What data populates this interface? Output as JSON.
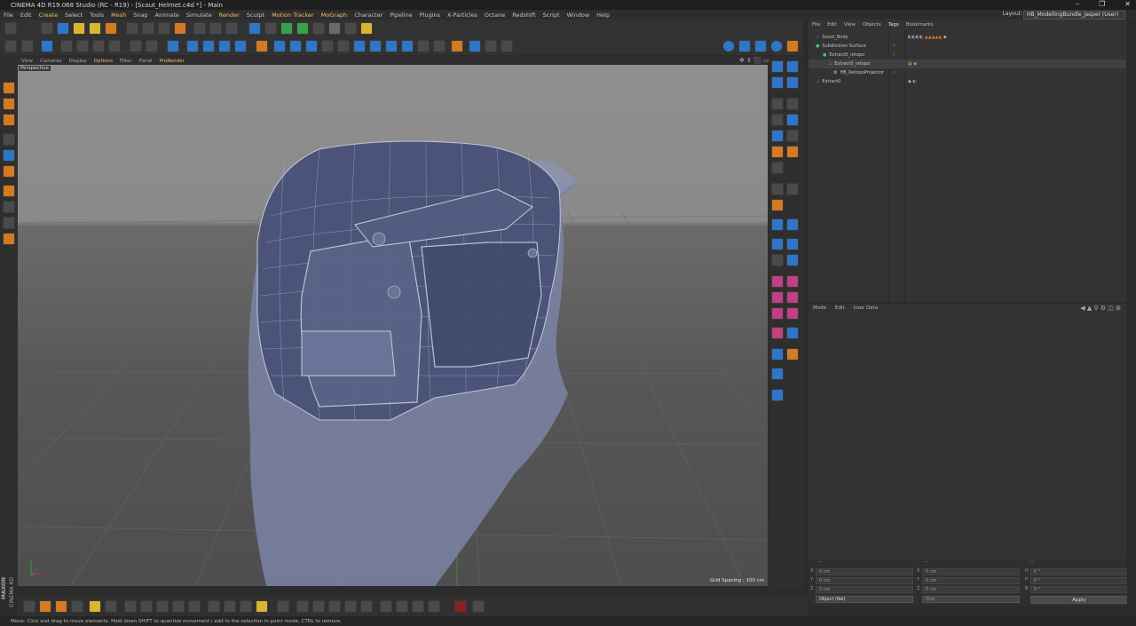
{
  "window": {
    "title": "CINEMA 4D R19.068 Studio (RC - R19) - [Scout_Helmet.c4d *] - Main"
  },
  "menu": [
    "File",
    "Edit",
    "Create",
    "Select",
    "Tools",
    "Mesh",
    "Snap",
    "Animate",
    "Simulate",
    "Render",
    "Sculpt",
    "Motion Tracker",
    "MoGraph",
    "Character",
    "Pipeline",
    "Plugins",
    "X-Particles",
    "Octane",
    "Redshift",
    "Script",
    "Window",
    "Help"
  ],
  "layout": {
    "label": "Layout:",
    "value": "HB_ModellingBundle_Jasper (User)"
  },
  "viewport": {
    "menu": [
      "View",
      "Cameras",
      "Display",
      "Options",
      "Filter",
      "Panel",
      "ProRender"
    ],
    "camera": "Perspective",
    "grid_spacing": "Grid Spacing : 100 cm"
  },
  "object_manager": {
    "menu": [
      "File",
      "Edit",
      "View",
      "Objects",
      "Tags",
      "Bookmarks"
    ],
    "objects": [
      {
        "name": "Scout_Body"
      },
      {
        "name": "Subdivision Surface"
      },
      {
        "name": "Extract0_retopo"
      },
      {
        "name": "Extract0_retopo"
      },
      {
        "name": "HB_RetopoProjector"
      },
      {
        "name": "Extract0"
      }
    ]
  },
  "attributes": {
    "menu": [
      "Mode",
      "Edit",
      "User Data"
    ]
  },
  "coordinates": {
    "header": [
      "--",
      "--",
      "--"
    ],
    "rows": [
      {
        "axis": "X",
        "pos": "0 cm",
        "size_axis": "X",
        "size": "0 cm",
        "rot_axis": "H",
        "rot": "0 °"
      },
      {
        "axis": "Y",
        "pos": "0 cm",
        "size_axis": "Y",
        "size": "0 cm",
        "rot_axis": "P",
        "rot": "0 °"
      },
      {
        "axis": "Z",
        "pos": "0 cm",
        "size_axis": "Z",
        "size": "0 cm",
        "rot_axis": "B",
        "rot": "0 °"
      }
    ],
    "mode": "Object (Rel)",
    "size_mode": "Size",
    "apply": "Apply"
  },
  "status": "Move: Click and drag to move elements. Hold down SHIFT to quantize movement / add to the selection in point mode, CTRL to remove.",
  "branding": {
    "line1": "MAXON",
    "line2": "CINEMA 4D"
  },
  "colors": {
    "accent": "#d47a22",
    "select_blue": "#2f75c8",
    "menu_highlight": "#f0c060"
  }
}
